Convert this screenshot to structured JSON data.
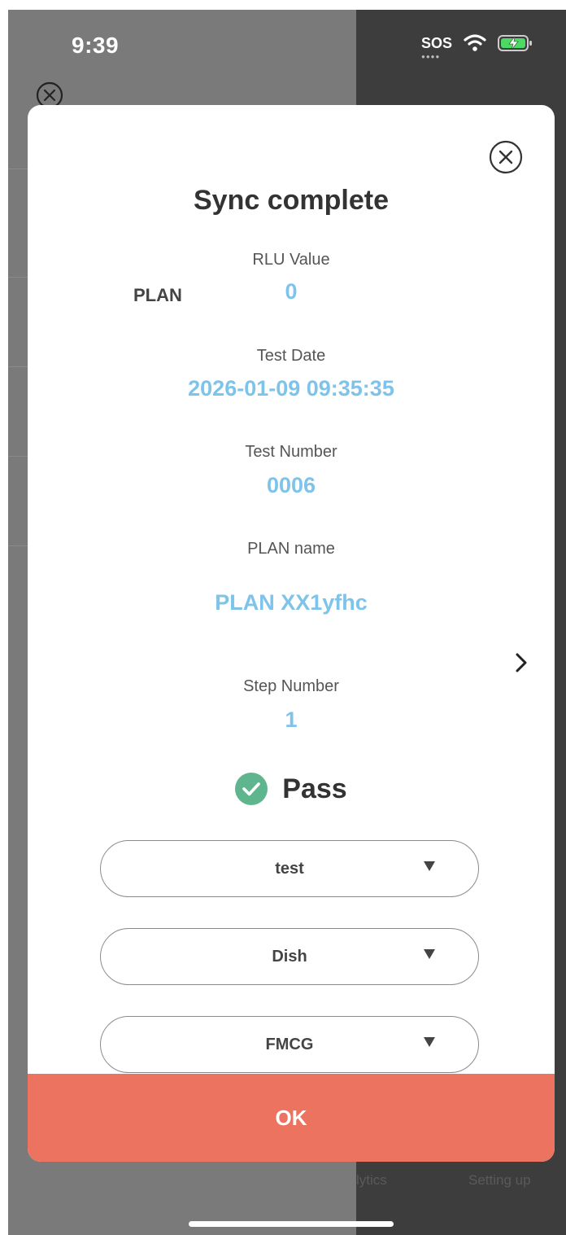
{
  "status_bar": {
    "time": "9:39",
    "sos": "SOS"
  },
  "background": {
    "tabs": [
      "lytics",
      "Setting up"
    ]
  },
  "modal": {
    "title": "Sync complete",
    "plan_tag": "PLAN",
    "fields": [
      {
        "label": "RLU Value",
        "value": "0"
      },
      {
        "label": "Test Date",
        "value": "2026-01-09 09:35:35"
      },
      {
        "label": "Test Number",
        "value": "0006"
      },
      {
        "label": "PLAN name",
        "value": "PLAN XX1yfhc"
      },
      {
        "label": "Step Number",
        "value": "1"
      }
    ],
    "result": "Pass",
    "dropdowns": [
      {
        "value": "test"
      },
      {
        "value": "Dish"
      },
      {
        "value": "FMCG"
      }
    ],
    "ok_label": "OK"
  },
  "colors": {
    "accent_value": "#7ec3ea",
    "ok_button": "#ec735f",
    "pass_green": "#5fb68e"
  }
}
